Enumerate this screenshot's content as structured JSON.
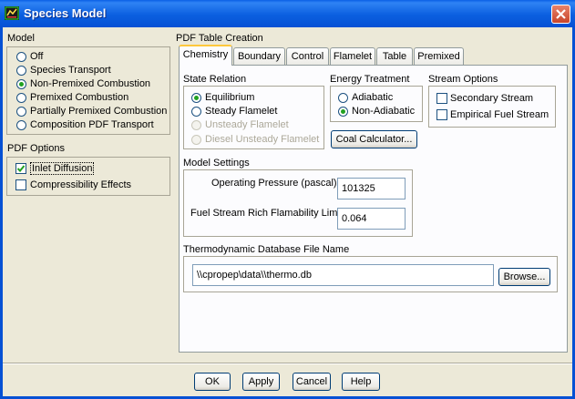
{
  "window": {
    "title": "Species Model"
  },
  "model": {
    "label": "Model",
    "options": [
      "Off",
      "Species Transport",
      "Non-Premixed Combustion",
      "Premixed Combustion",
      "Partially Premixed Combustion",
      "Composition PDF Transport"
    ],
    "selected": "Non-Premixed Combustion"
  },
  "pdf_options": {
    "label": "PDF Options",
    "inlet_diffusion": {
      "label": "Inlet Diffusion",
      "checked": true
    },
    "compressibility": {
      "label": "Compressibility Effects",
      "checked": false
    }
  },
  "pdf_table": {
    "label": "PDF Table Creation",
    "tabs": [
      "Chemistry",
      "Boundary",
      "Control",
      "Flamelet",
      "Table",
      "Premixed"
    ],
    "active_tab": "Chemistry"
  },
  "state_relation": {
    "label": "State Relation",
    "options": [
      "Equilibrium",
      "Steady Flamelet",
      "Unsteady Flamelet",
      "Diesel Unsteady Flamelet"
    ],
    "selected": "Equilibrium"
  },
  "energy_treatment": {
    "label": "Energy Treatment",
    "options": [
      "Adiabatic",
      "Non-Adiabatic"
    ],
    "selected": "Non-Adiabatic"
  },
  "stream_options": {
    "label": "Stream Options",
    "secondary": {
      "label": "Secondary Stream",
      "checked": false
    },
    "empirical": {
      "label": "Empirical Fuel Stream",
      "checked": false
    }
  },
  "coal_calculator_label": "Coal Calculator...",
  "model_settings": {
    "label": "Model Settings",
    "operating_pressure": {
      "label": "Operating Pressure (pascal)",
      "value": "101325"
    },
    "rich_limit": {
      "label": "Fuel Stream Rich Flamability Limit",
      "value": "0.064"
    }
  },
  "thermo_db": {
    "label": "Thermodynamic Database File Name",
    "value": "\\\\cpropep\\data\\\\thermo.db",
    "browse_label": "Browse..."
  },
  "buttons": {
    "ok": "OK",
    "apply": "Apply",
    "cancel": "Cancel",
    "help": "Help"
  },
  "colors": {
    "titlebar": "#0651d4",
    "dialog_bg": "#ece9d8",
    "radio_dot": "#21a121",
    "tab_highlight": "#ffc83c"
  }
}
